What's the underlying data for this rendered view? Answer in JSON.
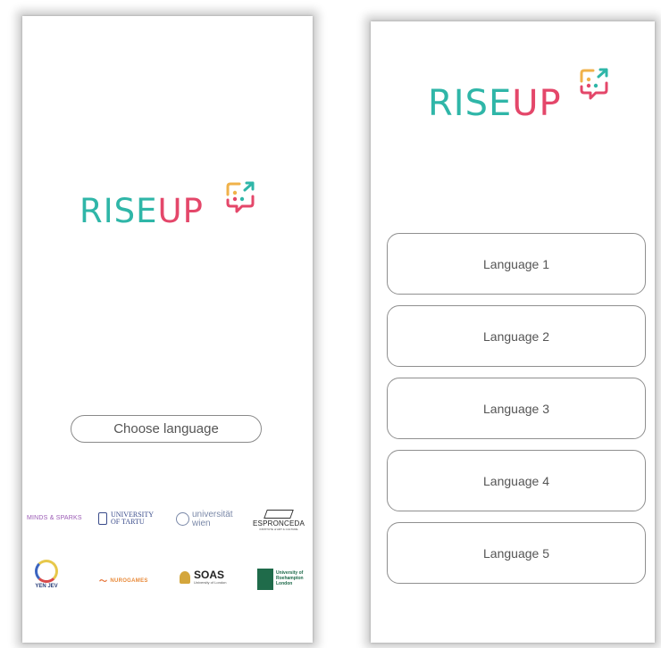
{
  "logo": {
    "text_rise": "RISE",
    "text_up": "UP",
    "color_rise": "#2fb6a8",
    "color_up": "#e4476a"
  },
  "screen_left": {
    "choose_language_label": "Choose language",
    "sponsors": {
      "minds": "MINDS & SPARKS",
      "tartu_line1": "UNIVERSITY",
      "tartu_line2": "OF TARTU",
      "wien_line1": "universität",
      "wien_line2": "wien",
      "espronceda": "ESPRONCEDA",
      "espronceda_sub": "INSTITUTE of ART & CULTURE",
      "yen": "YEN JEV",
      "nurogames": "NUROGAMES",
      "soas": "SOAS",
      "soas_sub": "University of London",
      "roehampton_line1": "University of",
      "roehampton_line2": "Roehampton",
      "roehampton_line3": "London"
    }
  },
  "screen_right": {
    "languages": [
      {
        "label": "Language 1"
      },
      {
        "label": "Language 2"
      },
      {
        "label": "Language 3"
      },
      {
        "label": "Language 4"
      },
      {
        "label": "Language 5"
      }
    ]
  }
}
